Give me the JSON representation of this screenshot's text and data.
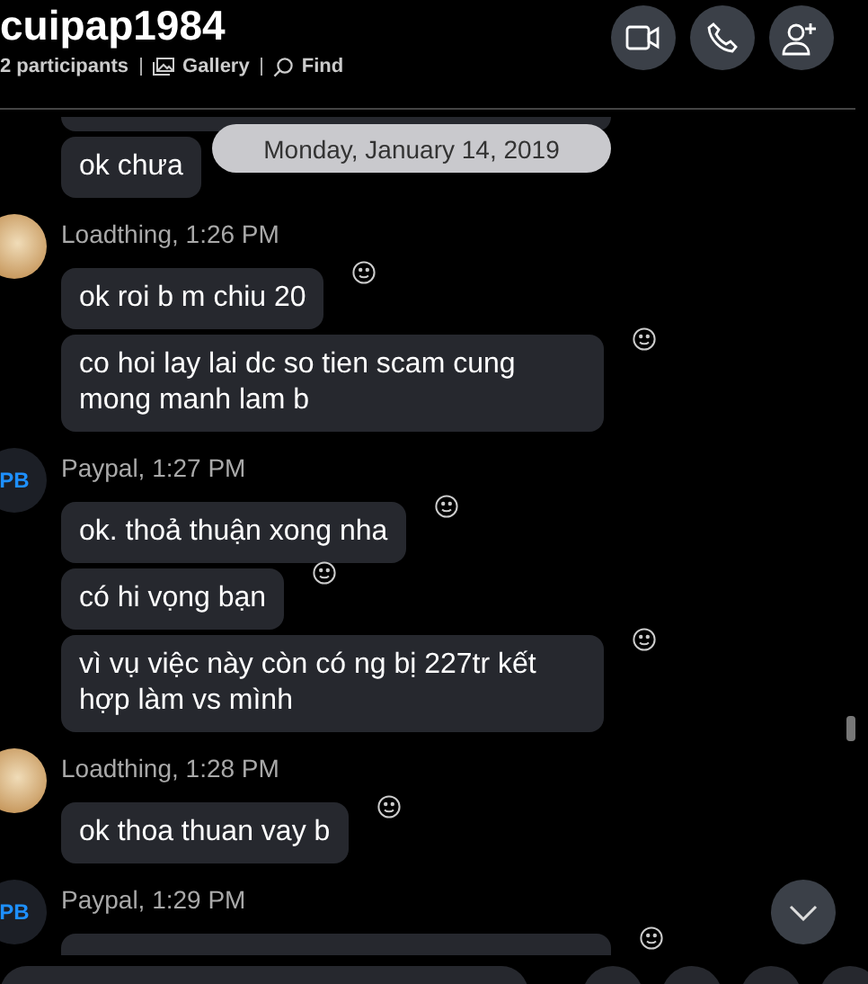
{
  "header": {
    "title": "cuipap1984",
    "participants": "2 participants",
    "links": [
      {
        "kind": "gallery",
        "label": "Gallery"
      },
      {
        "kind": "find",
        "label": "Find"
      }
    ],
    "buttons": [
      {
        "kind": "video"
      },
      {
        "kind": "call"
      },
      {
        "kind": "add-person"
      }
    ]
  },
  "date_divider": "Monday, January 14, 2019",
  "groups": [
    {
      "messages": [
        {
          "kind": "cut-off",
          "reaction": false
        },
        {
          "kind": "text",
          "text": "ok chưa",
          "reaction": false
        }
      ]
    },
    {
      "sender": "Loadthing, 1:26 PM",
      "avatar": {
        "kind": "photo"
      },
      "messages": [
        {
          "kind": "text",
          "text": "ok roi b m chiu 20",
          "reaction": true
        },
        {
          "kind": "text",
          "text": "co hoi lay lai dc so tien scam cung mong manh lam b",
          "reaction": true
        }
      ]
    },
    {
      "sender": "Paypal, 1:27 PM",
      "avatar": {
        "kind": "initials",
        "initials": "PB"
      },
      "messages": [
        {
          "kind": "text",
          "text": "ok. thoả thuận xong nha",
          "reaction": true
        },
        {
          "kind": "text",
          "text": "có hi vọng bạn",
          "reaction": true
        },
        {
          "kind": "text",
          "text": "vì vụ việc này còn có ng bị 227tr kết hợp làm vs mình",
          "reaction": true
        }
      ]
    },
    {
      "sender": "Loadthing, 1:28 PM",
      "avatar": {
        "kind": "photo"
      },
      "messages": [
        {
          "kind": "text",
          "text": "ok thoa thuan vay b",
          "reaction": true
        }
      ]
    },
    {
      "sender": "Paypal, 1:29 PM",
      "avatar": {
        "kind": "initials",
        "initials": "PB"
      },
      "messages": [
        {
          "kind": "cut-off",
          "reaction": true
        }
      ]
    }
  ]
}
